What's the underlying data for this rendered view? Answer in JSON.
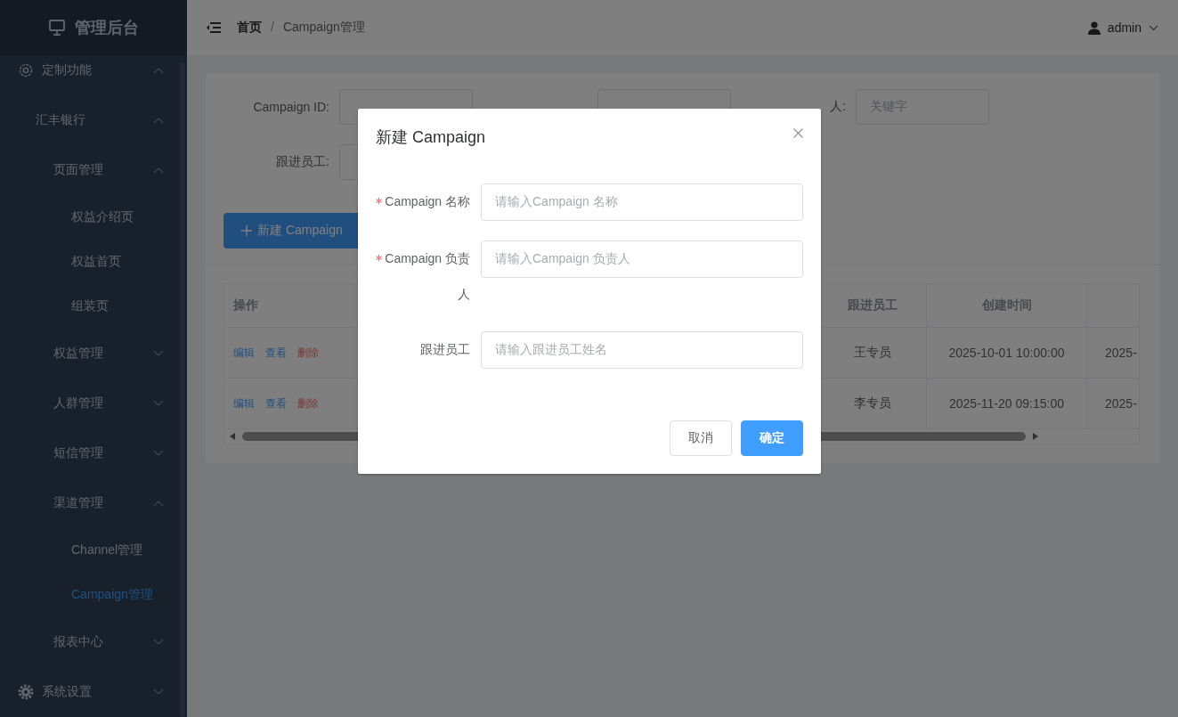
{
  "sidebar": {
    "title": "管理后台",
    "items": [
      {
        "label": "定制功能",
        "expanded": true,
        "children": [
          {
            "label": "汇丰银行",
            "expanded": true,
            "children": [
              {
                "label": "页面管理",
                "expanded": true,
                "children": [
                  {
                    "label": "权益介绍页",
                    "selected": false
                  },
                  {
                    "label": "权益首页",
                    "selected": false
                  },
                  {
                    "label": "组装页",
                    "selected": false
                  }
                ]
              },
              {
                "label": "权益管理",
                "expanded": false
              },
              {
                "label": "人群管理",
                "expanded": false
              },
              {
                "label": "短信管理",
                "expanded": false
              },
              {
                "label": "渠道管理",
                "expanded": true,
                "children": [
                  {
                    "label": "Channel管理",
                    "selected": false
                  },
                  {
                    "label": "Campaign管理",
                    "selected": true
                  }
                ]
              },
              {
                "label": "报表中心",
                "expanded": false
              }
            ]
          }
        ]
      },
      {
        "label": "系统设置",
        "expanded": false
      }
    ]
  },
  "header": {
    "breadcrumb": [
      "首页",
      "Campaign管理"
    ],
    "separator": "/",
    "user": "admin"
  },
  "search_form": {
    "fields": [
      {
        "label": "Campaign ID:"
      },
      {
        "label": "人:",
        "placeholder": "关键字"
      },
      {
        "label": "跟进员工:"
      }
    ],
    "new_button": "新建 Campaign"
  },
  "table": {
    "columns": [
      "操作",
      "",
      "跟进员工",
      "创建时间",
      ""
    ],
    "rows": [
      {
        "actions": [
          {
            "label": "编辑",
            "kind": "edit"
          },
          {
            "label": "查看",
            "kind": "view"
          },
          {
            "label": "删除",
            "kind": "delete"
          }
        ],
        "follower": "王专员",
        "created": "2025-10-01 10:00:00",
        "column_5": "2025-"
      },
      {
        "actions": [
          {
            "label": "编辑",
            "kind": "edit"
          },
          {
            "label": "查看",
            "kind": "view"
          },
          {
            "label": "删除",
            "kind": "delete"
          }
        ],
        "follower": "李专员",
        "created": "2025-11-20 09:15:00",
        "column_5": "2025-"
      }
    ]
  },
  "dialog": {
    "title": "新建 Campaign",
    "fields": [
      {
        "label": "Campaign 名称",
        "required": true,
        "placeholder": "请输入Campaign 名称"
      },
      {
        "label": "Campaign 负责人",
        "required": true,
        "placeholder": "请输入Campaign 负责人"
      },
      {
        "label": "跟进员工",
        "required": false,
        "placeholder": "请输入跟进员工姓名"
      }
    ],
    "buttons": [
      {
        "label": "取消",
        "kind": "default"
      },
      {
        "label": "确定",
        "kind": "primary"
      }
    ]
  }
}
